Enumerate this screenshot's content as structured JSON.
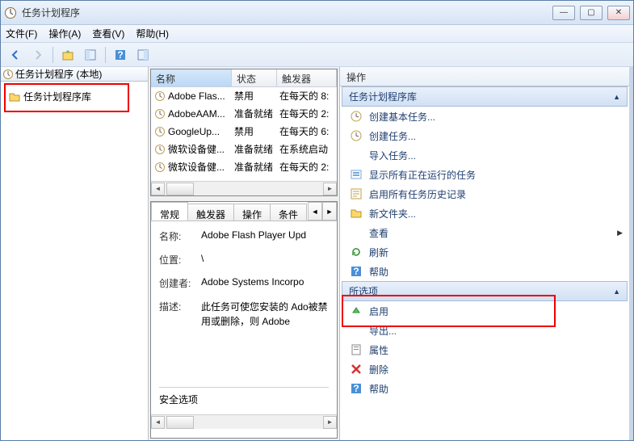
{
  "window": {
    "title": "任务计划程序"
  },
  "menu": {
    "file": "文件(F)",
    "action": "操作(A)",
    "view": "查看(V)",
    "help": "帮助(H)"
  },
  "tree": {
    "root": "任务计划程序 (本地)",
    "library": "任务计划程序库"
  },
  "task_grid": {
    "cols": {
      "name": "名称",
      "status": "状态",
      "trigger": "触发器"
    },
    "rows": [
      {
        "name": "Adobe Flas...",
        "status": "禁用",
        "trigger": "在每天的 8:"
      },
      {
        "name": "AdobeAAM...",
        "status": "准备就绪",
        "trigger": "在每天的 2:"
      },
      {
        "name": "GoogleUp...",
        "status": "禁用",
        "trigger": "在每天的 6:"
      },
      {
        "name": "微软设备健...",
        "status": "准备就绪",
        "trigger": "在系统启动"
      },
      {
        "name": "微软设备健...",
        "status": "准备就绪",
        "trigger": "在每天的 2:"
      }
    ]
  },
  "tabs": {
    "general": "常规",
    "triggers": "触发器",
    "actions": "操作",
    "conditions": "条件"
  },
  "form": {
    "name_label": "名称:",
    "name_value": "Adobe Flash Player Upd",
    "location_label": "位置:",
    "location_value": "\\",
    "author_label": "创建者:",
    "author_value": "Adobe Systems Incorpo",
    "desc_label": "描述:",
    "desc_value": "此任务可使您安装的 Ado被禁用或删除，则 Adobe",
    "security_label": "安全选项"
  },
  "actions_pane": {
    "header": "操作",
    "section1": "任务计划程序库",
    "items1": {
      "create_basic": "创建基本任务...",
      "create_task": "创建任务...",
      "import_task": "导入任务...",
      "show_running": "显示所有正在运行的任务",
      "enable_history": "启用所有任务历史记录",
      "new_folder": "新文件夹...",
      "view": "查看",
      "refresh": "刷新",
      "help": "帮助"
    },
    "section2": "所选项",
    "items2": {
      "enable": "启用",
      "export": "导出...",
      "properties": "属性",
      "delete": "删除",
      "help": "帮助"
    }
  }
}
